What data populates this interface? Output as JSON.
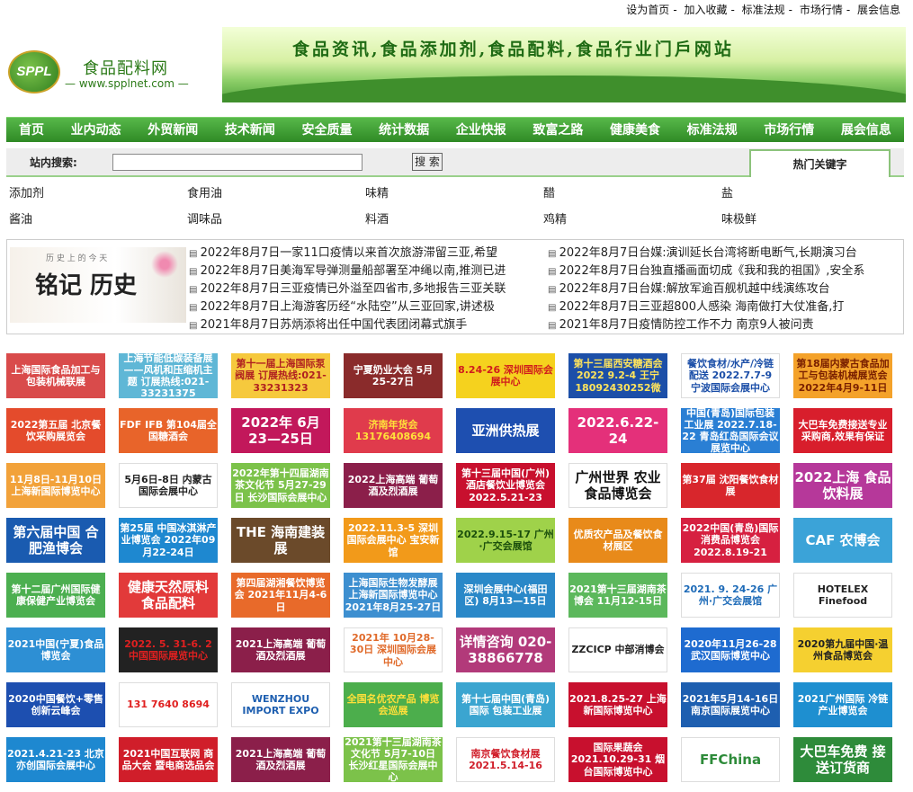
{
  "toplinks": [
    "设为首页",
    "加入收藏",
    "标准法规",
    "市场行情",
    "展会信息"
  ],
  "logo_text": "SPPL",
  "site_name": "食品配料网",
  "site_url": "— www.spplnet.com —",
  "banner_text": "食品资讯,食品添加剂,食品配料,食品行业门戶网站",
  "nav": [
    "首页",
    "业内动态",
    "外贸新闻",
    "技术新闻",
    "安全质量",
    "统计数据",
    "企业快报",
    "致富之路",
    "健康美食",
    "标准法规",
    "市场行情",
    "展会信息"
  ],
  "search": {
    "label": "站内搜索:",
    "button": "搜 索",
    "hot_tab": "热门关键字"
  },
  "keywords": [
    [
      "添加剂",
      "食用油",
      "味精",
      "醋",
      "盐"
    ],
    [
      "酱油",
      "调味品",
      "料酒",
      "鸡精",
      "味极鲜"
    ]
  ],
  "news_image": {
    "title": "铭记 历史",
    "subtitle": "历 史 上 的 今 天"
  },
  "news_left": [
    "2022年8月7日一家11口疫情以来首次旅游滞留三亚,希望",
    "2022年8月7日美海军导弹测量船部署至冲绳以南,推测已进",
    "2022年8月7日三亚疫情已外溢至四省市,多地报告三亚关联",
    "2022年8月7日上海游客历经“水陆空”从三亚回家,讲述极",
    "2021年8月7日苏炳添将出任中国代表团闭幕式旗手"
  ],
  "news_right": [
    "2022年8月7日台媒:演训延长台湾将断电断气,长期演习台",
    "2022年8月7日台独直播画面切成《我和我的祖国》,安全系",
    "2022年8月7日台媒:解放军逾百舰机越中线演练攻台",
    "2022年8月7日三亚超800人感染 海南做打大仗准备,打",
    "2021年8月7日疫情防控工作不力 南京9人被问责"
  ],
  "ads": [
    [
      {
        "t": "上海国际食品加工与包装机械联展",
        "bg": "#d94b4b",
        "c": "#fff"
      },
      {
        "t": "上海节能低碳装备展——风机和压缩机主题 订展热线:021-33231375",
        "bg": "#5fb7d6",
        "c": "#fff"
      },
      {
        "t": "第十一届上海国际泵阀展 订展热线:021-33231323",
        "bg": "#f6c93d",
        "c": "#b02020"
      },
      {
        "t": "宁夏奶业大会 5月25-27日",
        "bg": "#8a2b2b",
        "c": "#fff"
      },
      {
        "t": "8.24-26 深圳国际会展中心",
        "bg": "#f5d21e",
        "c": "#d01c1c"
      },
      {
        "t": "第十三届西安糖酒会 2022 9.2-4 王宁 18092430252微",
        "bg": "#1c4fa8",
        "c": "#ffe45c"
      },
      {
        "t": "餐饮食材/水产/冷链配送 2022.7.7-9 宁波国际会展中心",
        "bg": "#ffffff",
        "c": "#1c4fa8"
      },
      {
        "t": "第18届内蒙古食品加工与包装机械展览会 2022年4月9-11日",
        "bg": "#f4a22a",
        "c": "#7a2000"
      }
    ],
    [
      {
        "t": "2022第五届 北京餐饮采购展览会",
        "bg": "#e44b2c",
        "c": "#fff"
      },
      {
        "t": "FDF IFB 第104届全国糖酒会",
        "bg": "#e8642a",
        "c": "#fff"
      },
      {
        "t": "2022年 6月23—25日",
        "bg": "#c2185b",
        "c": "#fff",
        "big": true
      },
      {
        "t": "济南年货会 13176408694",
        "bg": "#e03b4c",
        "c": "#ffe03a"
      },
      {
        "t": "亚洲供热展",
        "bg": "#1e4fb0",
        "c": "#fff",
        "big": true
      },
      {
        "t": "2022.6.22-24",
        "bg": "#e4307a",
        "c": "#fff",
        "big": true
      },
      {
        "t": "中国(青岛)国际包装工业展 2022.7.18-22 青岛红岛国际会议展览中心",
        "bg": "#2a7fd4",
        "c": "#fff"
      },
      {
        "t": "大巴车免费接送专业采购商,效果有保证",
        "bg": "#d81e2c",
        "c": "#fff"
      }
    ],
    [
      {
        "t": "11月8日-11月10日 上海新国际博览中心",
        "bg": "#f2a23a",
        "c": "#fff"
      },
      {
        "t": "5月6日-8日 内蒙古国际会展中心",
        "bg": "#ffffff",
        "c": "#222"
      },
      {
        "t": "2022年第十四届湖南茶文化节 5月27-29日 长沙国际会展中心",
        "bg": "#7cc24a",
        "c": "#fff"
      },
      {
        "t": "2022上海高端 葡萄酒及烈酒展",
        "bg": "#8b1f4a",
        "c": "#fff"
      },
      {
        "t": "第十三届中国(广州)酒店餐饮业博览会 2022.5.21-23",
        "bg": "#c8102e",
        "c": "#fff"
      },
      {
        "t": "广州世界 农业食品博览会",
        "bg": "#ffffff",
        "c": "#111",
        "big": true
      },
      {
        "t": "第37届 沈阳餐饮食材展",
        "bg": "#d8262c",
        "c": "#fff"
      },
      {
        "t": "2022上海 食品饮料展",
        "bg": "#b6389a",
        "c": "#fff",
        "big": true
      }
    ],
    [
      {
        "t": "第六届中国 合肥渔博会",
        "bg": "#1a5bb0",
        "c": "#fff",
        "big": true
      },
      {
        "t": "第25届 中国冰淇淋产业博览会 2022年09月22-24日",
        "bg": "#1e88d0",
        "c": "#fff"
      },
      {
        "t": "THE 海南建装展",
        "bg": "#6b4a2a",
        "c": "#fff",
        "big": true
      },
      {
        "t": "2022.11.3-5 深圳国际会展中心 宝安新馆",
        "bg": "#f29a1a",
        "c": "#fff"
      },
      {
        "t": "2022.9.15-17 广州·广交会展馆",
        "bg": "#9fd24a",
        "c": "#1b4f0c"
      },
      {
        "t": "优质农产品及餐饮食材展区",
        "bg": "#e88a1a",
        "c": "#fff"
      },
      {
        "t": "2022中国(青岛)国际消费品博览会 2022.8.19-21",
        "bg": "#d62040",
        "c": "#fff"
      },
      {
        "t": "CAF 农博会",
        "bg": "#3ba3d8",
        "c": "#fff",
        "big": true
      }
    ],
    [
      {
        "t": "第十二届广州国际健康保健产业博览会",
        "bg": "#4caf50",
        "c": "#fff"
      },
      {
        "t": "健康天然原料 食品配料",
        "bg": "#e23a3a",
        "c": "#fff",
        "big": true
      },
      {
        "t": "第四届湖湘餐饮博览会 2021年11月4-6日",
        "bg": "#e86a2a",
        "c": "#fff"
      },
      {
        "t": "上海国际生物发酵展 上海新国际博览中心 2021年8月25-27日",
        "bg": "#3d8fd0",
        "c": "#fff"
      },
      {
        "t": "深圳会展中心(福田区) 8月13—15日",
        "bg": "#2a88c8",
        "c": "#fff"
      },
      {
        "t": "2021第十三届湖南茶博会 11月12-15日",
        "bg": "#5cb85c",
        "c": "#fff"
      },
      {
        "t": "2021. 9. 24-26 广州·广交会展馆",
        "bg": "#ffffff",
        "c": "#1e6bb8"
      },
      {
        "t": "HOTELEX Finefood",
        "bg": "#ffffff",
        "c": "#222"
      }
    ],
    [
      {
        "t": "2021中国(宁夏)食品博览会",
        "bg": "#2d8fd4",
        "c": "#fff"
      },
      {
        "t": "2022. 5. 31-6. 2 中国国际展览中心",
        "bg": "#222",
        "c": "#e02020"
      },
      {
        "t": "2021上海高端 葡萄酒及烈酒展",
        "bg": "#8b1f4a",
        "c": "#fff"
      },
      {
        "t": "2021年 10月28-30日 深圳国际会展中心",
        "bg": "#ffffff",
        "c": "#e06a2a"
      },
      {
        "t": "详情咨询 020-38866778",
        "bg": "#b23a7a",
        "c": "#fff",
        "big": true
      },
      {
        "t": "ZZCICP 中部消博会",
        "bg": "#ffffff",
        "c": "#222"
      },
      {
        "t": "2020年11月26-28 武汉国际博览中心",
        "bg": "#1e6bd0",
        "c": "#fff"
      },
      {
        "t": "2020第九届中国·温州食品博览会",
        "bg": "#f5d030",
        "c": "#222"
      }
    ],
    [
      {
        "t": "2020中国餐饮+零售创新云峰会",
        "bg": "#1d4fb0",
        "c": "#fff"
      },
      {
        "t": "131 7640 8694",
        "bg": "#ffffff",
        "c": "#e02020"
      },
      {
        "t": "WENZHOU IMPORT EXPO",
        "bg": "#ffffff",
        "c": "#1e5fb0"
      },
      {
        "t": "全国名优农产品 博览会巡展",
        "bg": "#4cae4c",
        "c": "#ffe03a"
      },
      {
        "t": "第十七届中国(青岛)国际 包装工业展",
        "bg": "#3ba5d0",
        "c": "#fff"
      },
      {
        "t": "2021.8.25-27 上海新国际博览中心",
        "bg": "#c8102e",
        "c": "#fff"
      },
      {
        "t": "2021年5月14-16日 南京国际展览中心",
        "bg": "#1e5fb0",
        "c": "#fff"
      },
      {
        "t": "2021广州国际 冷链产业博览会",
        "bg": "#1e8fd0",
        "c": "#fff"
      }
    ],
    [
      {
        "t": "2021.4.21-23 北京亦创国际会展中心",
        "bg": "#1e88d0",
        "c": "#fff"
      },
      {
        "t": "2021中国互联网 商品大会 暨电商选品会",
        "bg": "#d01e2a",
        "c": "#fff"
      },
      {
        "t": "2021上海高端 葡萄酒及烈酒展",
        "bg": "#8b1f4a",
        "c": "#fff"
      },
      {
        "t": "2021第十三届湖南茶文化节 5月7-10日 长沙红星国际会展中心",
        "bg": "#7cc24a",
        "c": "#fff"
      },
      {
        "t": "南京餐饮食材展 2021.5.14-16",
        "bg": "#ffffff",
        "c": "#d01e2a"
      },
      {
        "t": "国际果蔬会 2021.10.29-31 烟台国际博览中心",
        "bg": "#c8102e",
        "c": "#fff"
      },
      {
        "t": "FFChina",
        "bg": "#ffffff",
        "c": "#2e8b3a",
        "big": true
      },
      {
        "t": "大巴车免费 接送订货商",
        "bg": "#2e8b3a",
        "c": "#fff",
        "big": true
      }
    ]
  ]
}
